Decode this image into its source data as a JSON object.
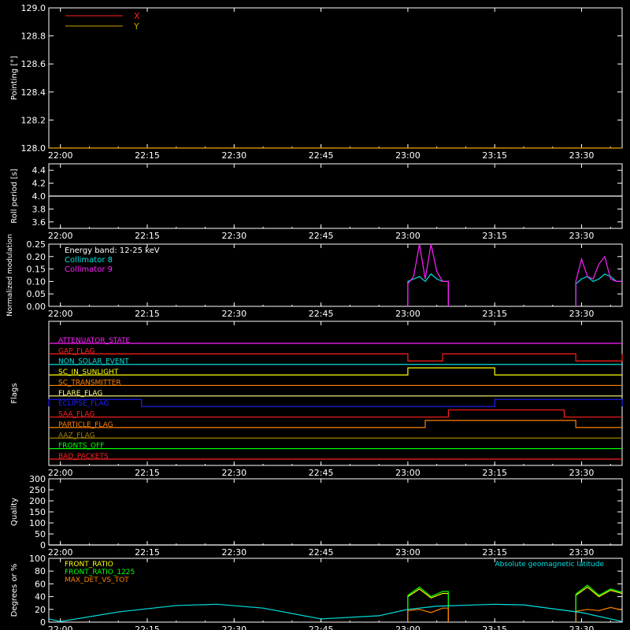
{
  "time_ticks": [
    "22:00",
    "22:15",
    "22:30",
    "22:45",
    "23:00",
    "23:15",
    "23:30"
  ],
  "time_range": [
    "21:58",
    "23:37"
  ],
  "colors": {
    "background": "#000000",
    "axes": "#ffffff",
    "x": "#ff2020",
    "y": "#c8a000",
    "collimator8": "#00e0e0",
    "collimator9": "#ff20ff",
    "front_ratio": "#ffff00",
    "front_ratio_1225": "#00ff00",
    "max_det": "#ff8000",
    "geomag": "#00e0e0"
  },
  "chart_data": [
    {
      "type": "line",
      "panel": "pointing",
      "ylabel": "Pointing [°]",
      "ylim": [
        128.0,
        129.0
      ],
      "yticks": [
        "128.0",
        "128.2",
        "128.4",
        "128.6",
        "128.8",
        "129.0"
      ],
      "legend": [
        "X",
        "Y"
      ],
      "series": [
        {
          "name": "X",
          "x": [
            "21:58",
            "23:37"
          ],
          "values": [
            128.0,
            128.0
          ]
        },
        {
          "name": "Y",
          "x": [
            "21:58",
            "23:37"
          ],
          "values": [
            128.0,
            128.0
          ]
        }
      ]
    },
    {
      "type": "line",
      "panel": "roll",
      "ylabel": "Roll period [s]",
      "ylim": [
        3.5,
        4.5
      ],
      "yticks": [
        "3.6",
        "3.8",
        "4.0",
        "4.2",
        "4.4"
      ],
      "series": [
        {
          "name": "roll",
          "x": [
            "21:58",
            "23:37"
          ],
          "values": [
            4.0,
            4.0
          ]
        }
      ]
    },
    {
      "type": "line",
      "panel": "modulation",
      "ylabel": "Normalized modulation",
      "ylim": [
        0.0,
        0.25
      ],
      "yticks": [
        "0.00",
        "0.05",
        "0.10",
        "0.15",
        "0.20",
        "0.25"
      ],
      "annotations": [
        "Energy band: 12-25 keV"
      ],
      "legend": [
        "Collimator 8",
        "Collimator 9"
      ],
      "series": [
        {
          "name": "Collimator 8",
          "x": [
            "23:00",
            "23:01",
            "23:02",
            "23:03",
            "23:04",
            "23:05",
            "23:06",
            "23:29",
            "23:30",
            "23:31",
            "23:32",
            "23:33",
            "23:34",
            "23:35",
            "23:36"
          ],
          "values": [
            0.1,
            0.11,
            0.12,
            0.1,
            0.13,
            0.11,
            0.1,
            0.09,
            0.11,
            0.12,
            0.1,
            0.11,
            0.13,
            0.12,
            0.1
          ]
        },
        {
          "name": "Collimator 9",
          "x": [
            "23:00",
            "23:01",
            "23:02",
            "23:03",
            "23:04",
            "23:05",
            "23:06",
            "23:29",
            "23:30",
            "23:31",
            "23:32",
            "23:33",
            "23:34",
            "23:35",
            "23:36"
          ],
          "values": [
            0.09,
            0.12,
            0.25,
            0.11,
            0.25,
            0.14,
            0.1,
            0.1,
            0.19,
            0.12,
            0.11,
            0.17,
            0.2,
            0.11,
            0.1
          ]
        }
      ]
    },
    {
      "type": "line",
      "panel": "flags",
      "ylabel": "Flags",
      "flags": [
        {
          "label": "ATTENUATOR_STATE",
          "color": "#ff20ff",
          "steps": []
        },
        {
          "label": "GAP_FLAG",
          "color": "#ff2020",
          "steps": [
            [
              "23:00",
              "23:06",
              -1
            ],
            [
              "23:29",
              "23:37",
              -1
            ]
          ]
        },
        {
          "label": "NON_SOLAR_EVENT",
          "color": "#00e0e0",
          "steps": []
        },
        {
          "label": "SC_IN_SUNLIGHT",
          "color": "#ffff00",
          "steps": [
            [
              "23:00",
              "23:15",
              1
            ]
          ]
        },
        {
          "label": "SC_TRANSMITTER",
          "color": "#ff8000",
          "steps": []
        },
        {
          "label": "FLARE_FLAG",
          "color": "#ffff80",
          "steps": []
        },
        {
          "label": "ECLIPSE_FLAG",
          "color": "#2020ff",
          "steps": [
            [
              "21:58",
              "22:14",
              1
            ],
            [
              "23:15",
              "23:37",
              1
            ]
          ]
        },
        {
          "label": "SAA_FLAG",
          "color": "#ff2020",
          "steps": [
            [
              "23:07",
              "23:27",
              1
            ]
          ]
        },
        {
          "label": "PARTICLE_FLAG",
          "color": "#ff8000",
          "steps": [
            [
              "23:03",
              "23:29",
              1
            ]
          ]
        },
        {
          "label": "AAZ_FLAG",
          "color": "#a08000",
          "steps": []
        },
        {
          "label": "FRONTS_OFF",
          "color": "#00ff00",
          "steps": []
        },
        {
          "label": "BAD_PACKETS",
          "color": "#ff2020",
          "steps": []
        }
      ]
    },
    {
      "type": "line",
      "panel": "quality",
      "ylabel": "Quality",
      "ylim": [
        0,
        300
      ],
      "yticks": [
        "0",
        "50",
        "100",
        "150",
        "200",
        "250",
        "300"
      ],
      "series": [
        {
          "name": "quality",
          "x": [
            "21:58",
            "23:37"
          ],
          "values": [
            0,
            0
          ]
        }
      ]
    },
    {
      "type": "line",
      "panel": "ratios",
      "ylabel": "Degrees or %",
      "ylim": [
        0,
        100
      ],
      "yticks": [
        "0",
        "20",
        "40",
        "60",
        "80",
        "100"
      ],
      "legend": [
        "FRONT_RATIO",
        "FRONT_RATIO_1225",
        "MAX_DET_VS_TOT"
      ],
      "annotations": [
        "Absolute geomagnetic latitude"
      ],
      "series": [
        {
          "name": "FRONT_RATIO",
          "x": [
            "23:00",
            "23:02",
            "23:04",
            "23:06",
            "23:29",
            "23:31",
            "23:33",
            "23:35",
            "23:37"
          ],
          "values": [
            40,
            52,
            38,
            45,
            42,
            55,
            40,
            50,
            45
          ]
        },
        {
          "name": "FRONT_RATIO_1225",
          "x": [
            "23:00",
            "23:02",
            "23:04",
            "23:06",
            "23:29",
            "23:31",
            "23:33",
            "23:35",
            "23:37"
          ],
          "values": [
            42,
            55,
            40,
            48,
            44,
            58,
            42,
            52,
            47
          ]
        },
        {
          "name": "MAX_DET_VS_TOT",
          "x": [
            "23:00",
            "23:02",
            "23:04",
            "23:06",
            "23:29",
            "23:31",
            "23:33",
            "23:35",
            "23:37"
          ],
          "values": [
            18,
            20,
            15,
            22,
            17,
            20,
            18,
            23,
            19
          ]
        },
        {
          "name": "Absolute geomagnetic latitude",
          "x": [
            "21:58",
            "22:00",
            "22:10",
            "22:20",
            "22:27",
            "22:35",
            "22:45",
            "22:55",
            "23:00",
            "23:05",
            "23:15",
            "23:20",
            "23:30",
            "23:37"
          ],
          "values": [
            5,
            1,
            16,
            26,
            28,
            22,
            5,
            10,
            20,
            25,
            28,
            27,
            15,
            1
          ]
        }
      ]
    }
  ]
}
